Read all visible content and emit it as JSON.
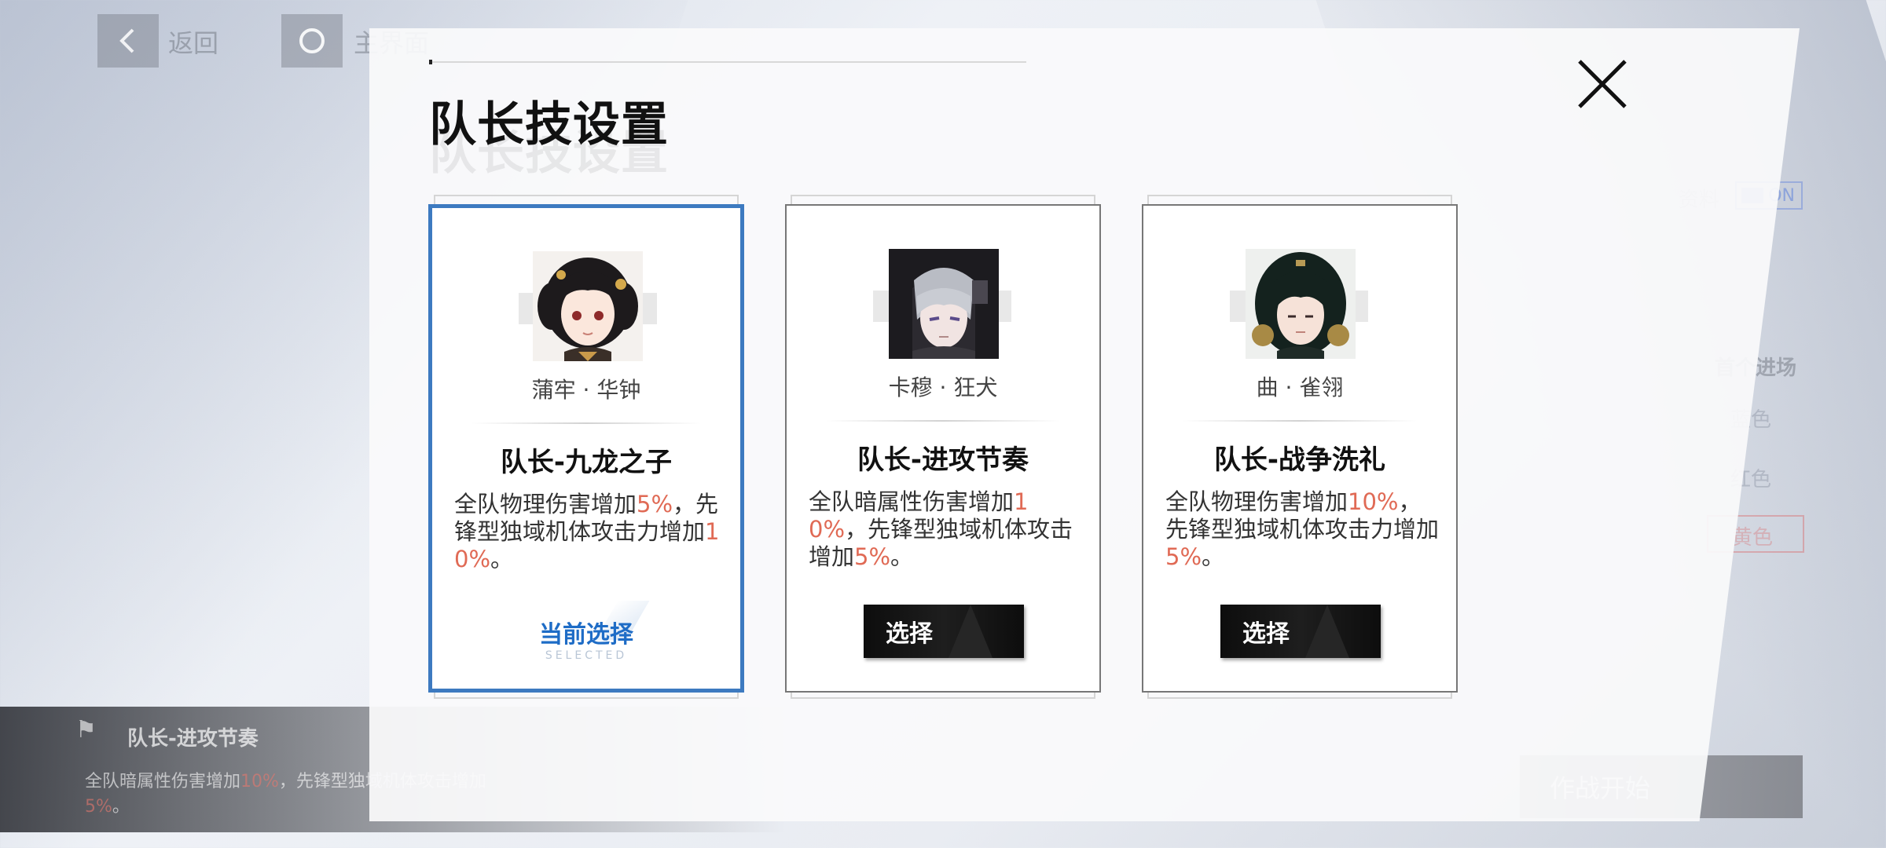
{
  "nav": {
    "back_label": "返回",
    "home_label": "主界面"
  },
  "background": {
    "right_labels": [
      "资料",
      "首个进场",
      "蓝色",
      "红色",
      "黄色"
    ],
    "toggle_label": "ON",
    "bottom_panel": {
      "title": "队长-进攻节奏",
      "desc_a": "全队暗属性伤害增加",
      "desc_hl1": "10%",
      "desc_b": "，先锋型独域机体攻击增加",
      "desc_hl2": "5%",
      "desc_c": "。"
    },
    "start_button_label": "作战开始"
  },
  "modal": {
    "title": "队长技设置",
    "cards": [
      {
        "character": "蒲牢 · 华钟",
        "skill_name": "队长-九龙之子",
        "desc": [
          {
            "t": "全队物理伤害增加",
            "h": false
          },
          {
            "t": "5%",
            "h": true
          },
          {
            "t": "，先锋型独域机体攻击力增加",
            "h": false
          },
          {
            "t": "10%",
            "h": true
          },
          {
            "t": "。",
            "h": false
          }
        ],
        "selected": true,
        "status_label": "当前选择",
        "status_sub": "SELECTED"
      },
      {
        "character": "卡穆 · 狂犬",
        "skill_name": "队长-进攻节奏",
        "desc": [
          {
            "t": "全队暗属性伤害增加",
            "h": false
          },
          {
            "t": "10%",
            "h": true
          },
          {
            "t": "，先锋型独域机体攻击增加",
            "h": false
          },
          {
            "t": "5%",
            "h": true
          },
          {
            "t": "。",
            "h": false
          }
        ],
        "selected": false,
        "button_label": "选择"
      },
      {
        "character": "曲 · 雀翎",
        "skill_name": "队长-战争洗礼",
        "desc": [
          {
            "t": "全队物理伤害增加",
            "h": false
          },
          {
            "t": "10%",
            "h": true
          },
          {
            "t": "，先锋型独域机体攻击力增加",
            "h": false
          },
          {
            "t": "5%",
            "h": true
          },
          {
            "t": "。",
            "h": false
          }
        ],
        "selected": false,
        "button_label": "选择"
      }
    ]
  },
  "colors": {
    "accent_blue": "#1e6cc6",
    "selected_border": "#3d7ac0",
    "highlight_red": "#e06a55"
  },
  "icons": [
    "back-arrow-icon",
    "home-circle-icon",
    "close-icon",
    "flag-icon"
  ]
}
